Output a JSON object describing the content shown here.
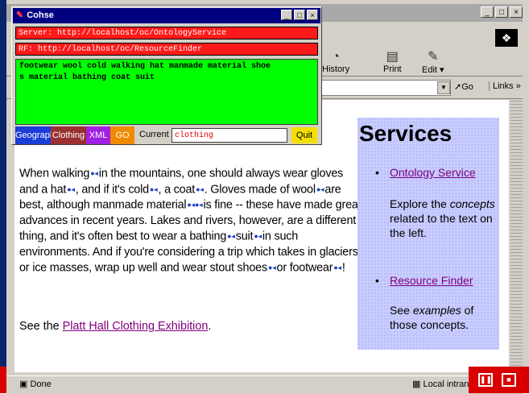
{
  "cohse": {
    "title": "Cohse",
    "server_bar": "Server: http://localhost/oc/OntologyService",
    "rf_bar": "RF: http://localhost/oc/ResourceFinder",
    "terms": "footwear wool cold walking hat manmade material shoe\ns material bathing coat suit",
    "buttons": [
      {
        "label": "Geography",
        "color": "#1a3cd8"
      },
      {
        "label": "Clothing",
        "color": "#9a3030"
      },
      {
        "label": "XML",
        "color": "#a020e0"
      },
      {
        "label": "GO",
        "color": "#f08a00"
      }
    ],
    "current_label": "Current",
    "current_value": "clothing",
    "quit_label": "Quit"
  },
  "browser": {
    "toolbar": {
      "history": "History",
      "print": "Print",
      "edit": "Edit"
    },
    "go": "Go",
    "links": "Links »",
    "status_left": "Done",
    "status_zone": "Local intran"
  },
  "page": {
    "paragraph": {
      "s1": "When walking",
      "s2": "in the mountains, one should always wear gloves and a hat",
      "s3": ", and if it's cold",
      "s4": ", a coat",
      "s5": ". Gloves made of wool",
      "s6": "are best, although manmade material",
      "s7": "is fine -- these have made great advances in recent years. Lakes and rivers, however, are a different thing, and it's often best to wear a bathing",
      "s8": "suit",
      "s9": "in such environments. And if you're considering a trip which takes in glaciers or ice masses, wrap up well and wear stout shoes",
      "s10": "or footwear",
      "s11": "!"
    },
    "see_prefix": "See the ",
    "see_link": "Platt Hall Clothing Exhibition",
    "see_suffix": "."
  },
  "services": {
    "heading": "Services",
    "items": [
      {
        "link": "Ontology Service",
        "description": "Explore the concepts related to the text on the left."
      },
      {
        "link": "Resource Finder",
        "description": "See examples of those concepts."
      }
    ]
  },
  "colors": {
    "red_bar": "#ff1a1a",
    "term_green": "#00ff00",
    "services_bg": "#c8ccff",
    "visited_link": "#800080"
  }
}
